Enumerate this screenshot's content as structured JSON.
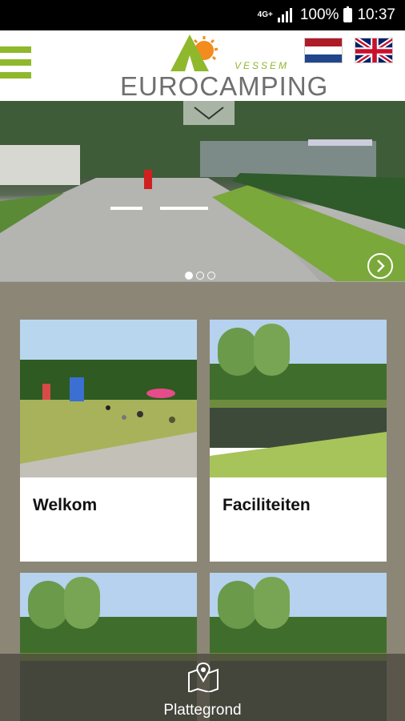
{
  "status_bar": {
    "network": "4G+",
    "battery": "100%",
    "time": "10:37"
  },
  "header": {
    "logo_subtitle": "VESSEM",
    "logo_title": "EUROCAMPING"
  },
  "languages": [
    {
      "code": "nl",
      "icon": "netherlands-flag-icon"
    },
    {
      "code": "en",
      "icon": "uk-flag-icon"
    }
  ],
  "slider": {
    "slide_count": 3,
    "active_slide": 1
  },
  "cards": [
    {
      "title": "Welkom"
    },
    {
      "title": "Faciliteiten"
    },
    {
      "title": ""
    },
    {
      "title": ""
    }
  ],
  "bottom_nav": {
    "label": "Plattegrond",
    "icon": "map-pin-icon"
  },
  "colors": {
    "accent_green": "#8fb82c",
    "logo_orange": "#f28c1c",
    "background": "#8c8677"
  }
}
